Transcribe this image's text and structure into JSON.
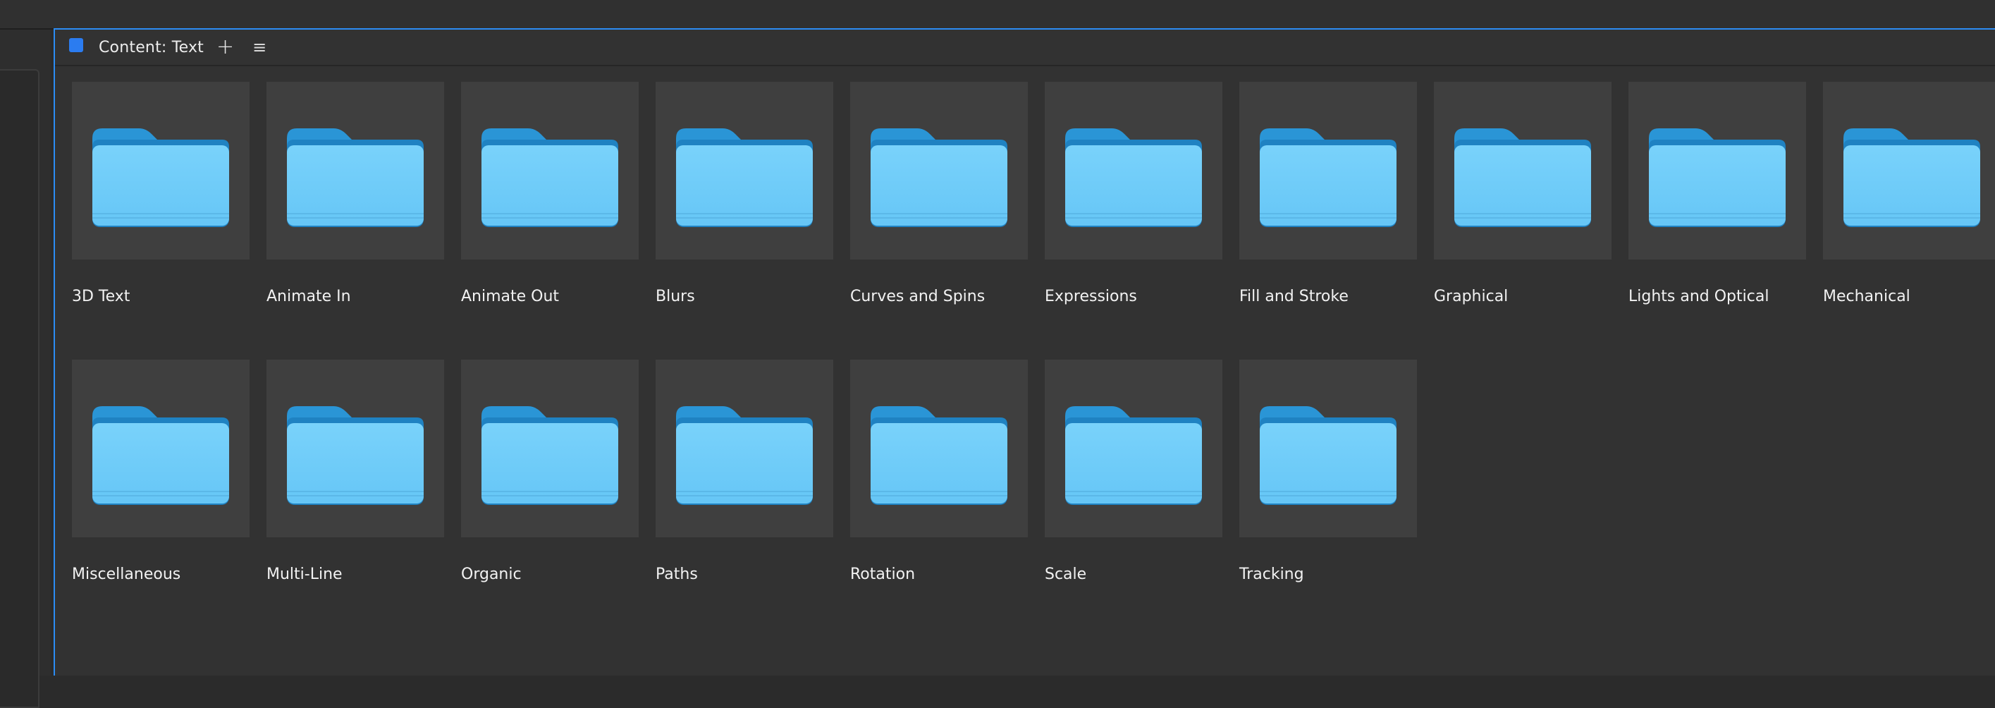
{
  "panel": {
    "title": "Content: Text",
    "accent_color": "#2b7cf0",
    "add_icon": "plus-icon",
    "menu_icon": "hamburger-menu-icon"
  },
  "folders": [
    {
      "label": "3D Text",
      "icon": "folder-icon"
    },
    {
      "label": "Animate In",
      "icon": "folder-icon"
    },
    {
      "label": "Animate Out",
      "icon": "folder-icon"
    },
    {
      "label": "Blurs",
      "icon": "folder-icon"
    },
    {
      "label": "Curves and Spins",
      "icon": "folder-icon"
    },
    {
      "label": "Expressions",
      "icon": "folder-icon"
    },
    {
      "label": "Fill and Stroke",
      "icon": "folder-icon"
    },
    {
      "label": "Graphical",
      "icon": "folder-icon"
    },
    {
      "label": "Lights and Optical",
      "icon": "folder-icon"
    },
    {
      "label": "Mechanical",
      "icon": "folder-icon"
    },
    {
      "label": "Miscellaneous",
      "icon": "folder-icon"
    },
    {
      "label": "Multi-Line",
      "icon": "folder-icon"
    },
    {
      "label": "Organic",
      "icon": "folder-icon"
    },
    {
      "label": "Paths",
      "icon": "folder-icon"
    },
    {
      "label": "Rotation",
      "icon": "folder-icon"
    },
    {
      "label": "Scale",
      "icon": "folder-icon"
    },
    {
      "label": "Tracking",
      "icon": "folder-icon"
    }
  ]
}
